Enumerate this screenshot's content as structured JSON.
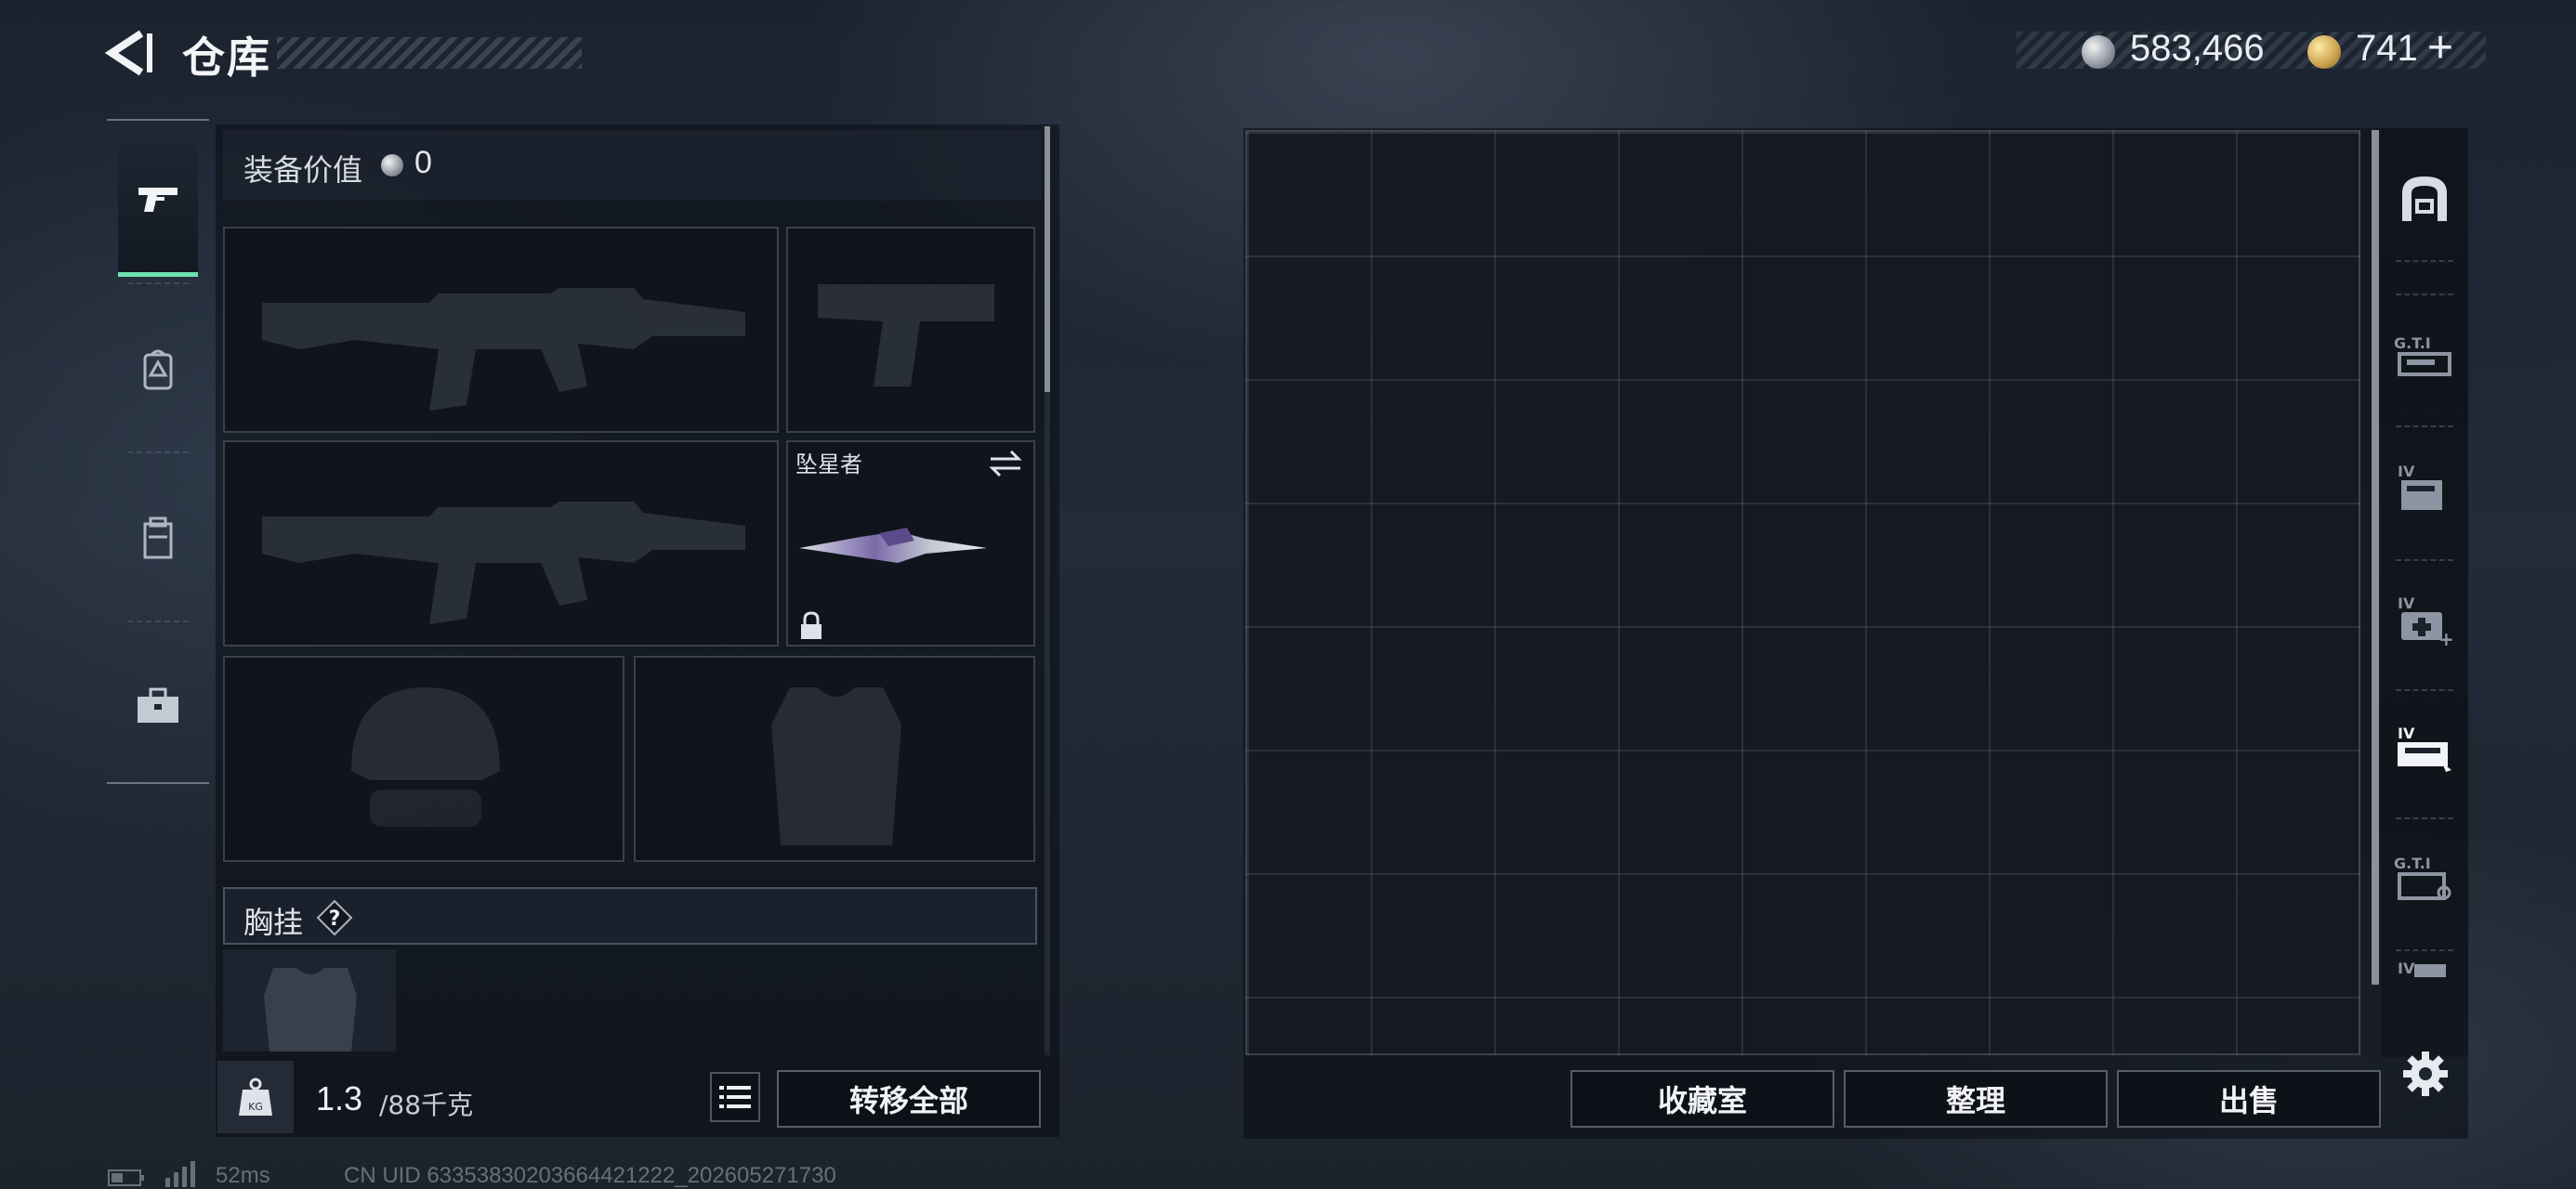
{
  "header": {
    "title": "仓库",
    "currency": {
      "silver_amount": "583,466",
      "gold_amount": "741",
      "plus_label": "+"
    }
  },
  "sidebar": {
    "tabs": [
      {
        "name": "weapons",
        "icon": "pistol-icon",
        "active": true
      },
      {
        "name": "backpack",
        "icon": "backpack-icon",
        "active": false
      },
      {
        "name": "chest-rig",
        "icon": "vest-icon",
        "active": false
      },
      {
        "name": "case",
        "icon": "briefcase-icon",
        "active": false
      }
    ]
  },
  "loadout": {
    "equip_value_label": "装备价值",
    "equip_value": "0",
    "melee_name": "坠星者",
    "chest_rig_label": "胸挂",
    "help_label": "?",
    "weight_current": "1.3",
    "weight_max": "/88千克",
    "transfer_all_label": "转移全部"
  },
  "storage": {
    "collection_label": "收藏室",
    "organize_label": "整理",
    "sell_label": "出售",
    "container_tabs": [
      "garage-icon",
      "gti-container-icon",
      "tier4-box-icon",
      "tier4-medkit-icon",
      "tier4-case-icon",
      "gti-key-case-icon",
      "tier4-partial-icon"
    ]
  },
  "status": {
    "ping": "52ms",
    "uid": "CN UID 63353830203664421222_202605271730"
  },
  "colors": {
    "accent": "#6fe0b0",
    "silver_coin": "#a9b0b8",
    "gold_coin": "#c9a04a"
  }
}
